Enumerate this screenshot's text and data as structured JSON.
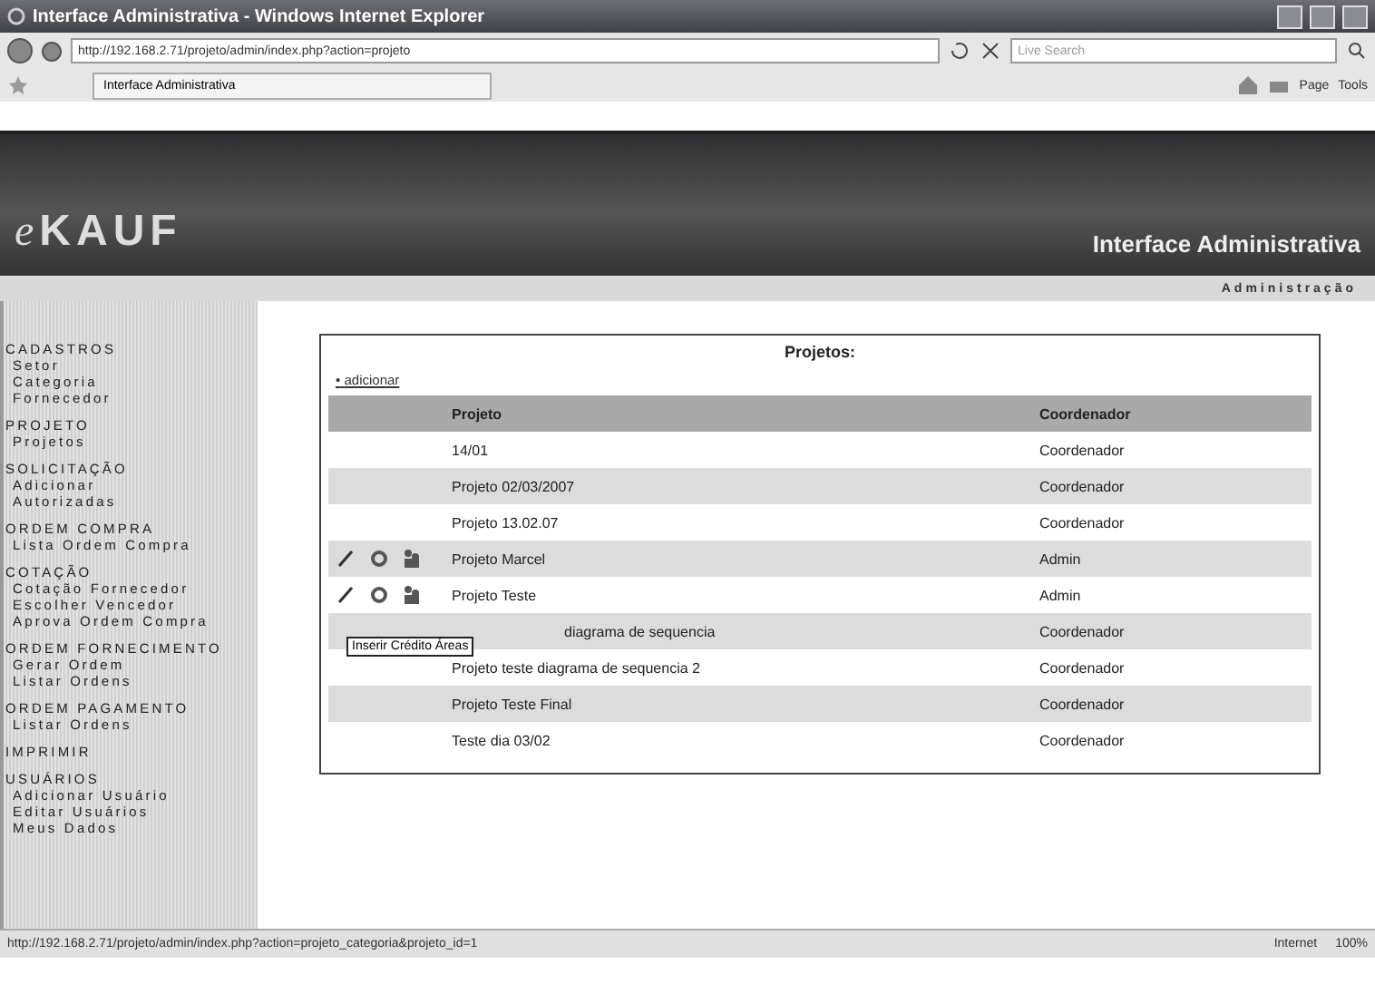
{
  "window": {
    "title": "Interface Administrativa - Windows Internet Explorer"
  },
  "address_bar": {
    "url": "http://192.168.2.71/projeto/admin/index.php?action=projeto",
    "search_placeholder": "Live Search"
  },
  "tab": {
    "label": "Interface Administrativa"
  },
  "command_bar": {
    "items": [
      "Page",
      "Tools"
    ]
  },
  "banner": {
    "logo_prefix": "e",
    "logo": "KAUF",
    "title": "Interface Administrativa",
    "subtitle": "Administração"
  },
  "sidebar": {
    "sections": [
      {
        "title": "CADASTROS",
        "items": [
          "Setor",
          "Categoria",
          "Fornecedor"
        ]
      },
      {
        "title": "PROJETO",
        "items": [
          "Projetos"
        ]
      },
      {
        "title": "SOLICITAÇÃO",
        "items": [
          "Adicionar",
          "Autorizadas"
        ]
      },
      {
        "title": "ORDEM COMPRA",
        "items": [
          "Lista Ordem Compra"
        ]
      },
      {
        "title": "COTAÇÃO",
        "items": [
          "Cotação Fornecedor",
          "Escolher Vencedor",
          "Aprova Ordem Compra"
        ]
      },
      {
        "title": "ORDEM FORNECIMENTO",
        "items": [
          "Gerar Ordem",
          "Listar Ordens"
        ]
      },
      {
        "title": "ORDEM PAGAMENTO",
        "items": [
          "Listar Ordens"
        ]
      },
      {
        "title": "IMPRIMIR"
      },
      {
        "title": "USUÁRIOS",
        "items": [
          "Adicionar Usuário",
          "Editar Usuários",
          "Meus Dados"
        ]
      }
    ]
  },
  "panel": {
    "title": "Projetos:",
    "add_bullet": "•",
    "add_link": "adicionar",
    "columns": [
      "Projeto",
      "Coordenador"
    ],
    "rows": [
      {
        "project": "14/01",
        "coordinator": "Coordenador",
        "actions": false
      },
      {
        "project": "Projeto 02/03/2007",
        "coordinator": "Coordenador",
        "actions": false
      },
      {
        "project": "Projeto 13.02.07",
        "coordinator": "Coordenador",
        "actions": false
      },
      {
        "project": "Projeto Marcel",
        "coordinator": "Admin",
        "actions": true
      },
      {
        "project": "Projeto Teste",
        "coordinator": "Admin",
        "actions": true
      },
      {
        "project": "diagrama de sequencia",
        "coordinator": "Coordenador",
        "actions": false
      },
      {
        "project": "Projeto teste diagrama de sequencia 2",
        "coordinator": "Coordenador",
        "actions": false
      },
      {
        "project": "Projeto Teste Final",
        "coordinator": "Coordenador",
        "actions": false
      },
      {
        "project": "Teste dia 03/02",
        "coordinator": "Coordenador",
        "actions": false
      }
    ],
    "tooltip": "Inserir Crédito Áreas"
  },
  "status_bar": {
    "url": "http://192.168.2.71/projeto/admin/index.php?action=projeto_categoria&projeto_id=1",
    "zone": "Internet",
    "zoom": "100%"
  }
}
